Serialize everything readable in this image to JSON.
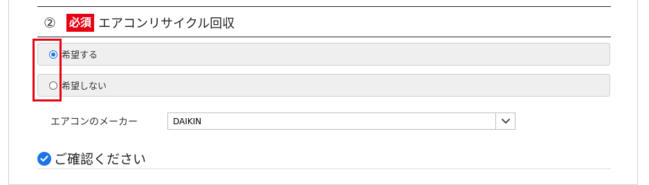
{
  "section": {
    "step_number": "②",
    "required_badge": "必須",
    "title": "エアコンリサイクル回収"
  },
  "recycle_options": [
    {
      "label": "希望する",
      "checked": true
    },
    {
      "label": "希望しない",
      "checked": false
    }
  ],
  "aircon_maker": {
    "label": "エアコンのメーカー",
    "selected": "DAIKIN",
    "icon": "chevron-down-icon"
  },
  "confirm": {
    "icon": "check-circle-icon",
    "text": "ご確認ください"
  },
  "colors": {
    "required_badge": "#e60012",
    "accent": "#1a73e8",
    "highlight": "#e60012"
  }
}
